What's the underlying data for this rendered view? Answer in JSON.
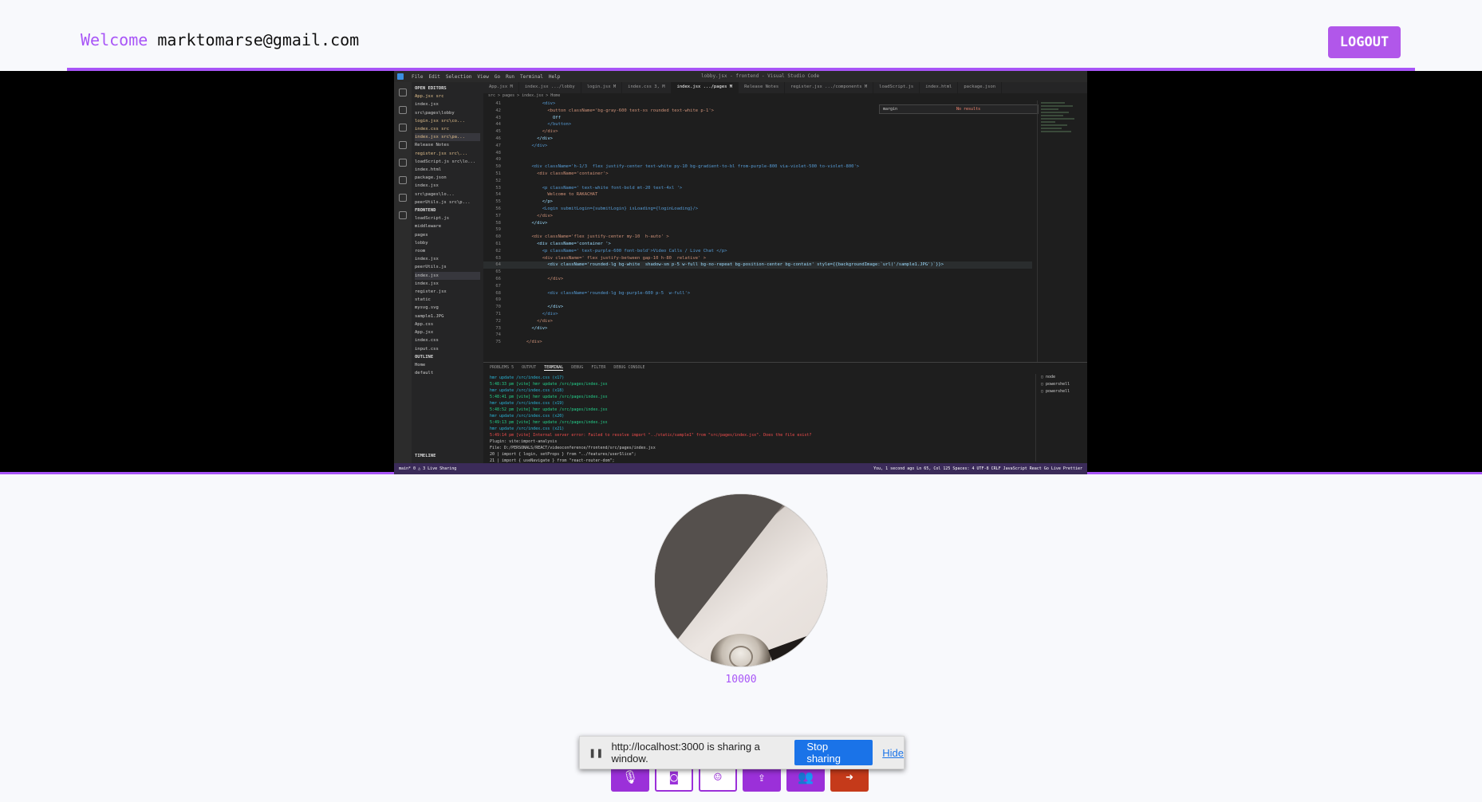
{
  "header": {
    "welcome_label": "Welcome",
    "email": "marktomarse@gmail.com",
    "logout_label": "LOGOUT"
  },
  "shared_screen": {
    "window_title": "lobby.jsx - frontend - Visual Studio Code",
    "menus": [
      "File",
      "Edit",
      "Selection",
      "View",
      "Go",
      "Run",
      "Terminal",
      "Help"
    ],
    "tabs": [
      "App.jsx M",
      "index.jsx .../lobby",
      "login.jsx M",
      "index.css 3, M",
      "index.jsx .../pages M",
      "Release Notes",
      "register.jsx .../components M",
      "loadScript.js",
      "index.html",
      "package.json"
    ],
    "breadcrumb": "src > pages > index.jsx > Home",
    "explorer": {
      "open_editors": "OPEN EDITORS",
      "frontend": "FRONTEND",
      "outline": "OUTLINE",
      "timeline": "TIMELINE",
      "files": [
        "App.jsx src",
        "index.jsx src\\pages\\lobby",
        "login.jsx src\\co...",
        "index.css src",
        "index.jsx src\\pa...",
        "Release Notes",
        "register.jsx src\\...",
        "loadScript.js src\\lo...",
        "index.html",
        "package.json",
        "index.jsx src\\pages\\lo...",
        "peerUtils.js src\\p...",
        "loadScript.js",
        "middleware",
        "pages",
        "lobby",
        "room",
        "index.jsx",
        "peerUtils.js",
        "index.jsx",
        "index.jsx",
        "register.jsx",
        "static",
        "mysvg.svg",
        "sample1.JPG",
        "App.css",
        "App.jsx",
        "index.css",
        "input.css",
        "Home",
        "default"
      ]
    },
    "code_lines": [
      {
        "n": "41",
        "text": "            <div>"
      },
      {
        "n": "42",
        "text": "              <button className='bg-gray-600 text-xs rounded text-white p-1'>"
      },
      {
        "n": "43",
        "text": "                Off"
      },
      {
        "n": "44",
        "text": "              </button>"
      },
      {
        "n": "45",
        "text": "            </div>"
      },
      {
        "n": "46",
        "text": "          </div>"
      },
      {
        "n": "47",
        "text": "        </div>"
      },
      {
        "n": "48",
        "text": ""
      },
      {
        "n": "49",
        "text": ""
      },
      {
        "n": "50",
        "text": "        <div className='h-1/3  flex justify-center text-white py-10 bg-gradient-to-bl from-purple-800 via-violet-500 to-violet-800'>"
      },
      {
        "n": "51",
        "text": "          <div className='container'>"
      },
      {
        "n": "52",
        "text": ""
      },
      {
        "n": "53",
        "text": "            <p className=' text-white font-bold mt-20 text-4xl '>"
      },
      {
        "n": "54",
        "text": "              Welcome to RAKACHAT"
      },
      {
        "n": "55",
        "text": "            </p>"
      },
      {
        "n": "56",
        "text": "            <Login submitLogin={submitLogin} isLoading={loginLoading}/>"
      },
      {
        "n": "57",
        "text": "          </div>"
      },
      {
        "n": "58",
        "text": "        </div>"
      },
      {
        "n": "59",
        "text": ""
      },
      {
        "n": "60",
        "text": "        <div className='flex justify-center my-10  h-auto' >"
      },
      {
        "n": "61",
        "text": "          <div className='container '>"
      },
      {
        "n": "62",
        "text": "            <p className=' text-purple-600 font-bold'>Video Calls / Live Chat </p>"
      },
      {
        "n": "63",
        "text": "            <div className=' flex justify-between gap-10 h-80  relative' >"
      },
      {
        "n": "64",
        "text": "              <div className='rounded-lg bg-white  shadow-sm p-5 w-full bg-no-repeat bg-position-center bg-contain' style={{backgroundImage:`url('/sample1.JPG')`}}>"
      },
      {
        "n": "65",
        "text": ""
      },
      {
        "n": "66",
        "text": "              </div>"
      },
      {
        "n": "67",
        "text": ""
      },
      {
        "n": "68",
        "text": "              <div className='rounded-lg bg-purple-600 p-5  w-full'>"
      },
      {
        "n": "69",
        "text": ""
      },
      {
        "n": "70",
        "text": "              </div>"
      },
      {
        "n": "71",
        "text": "            </div>"
      },
      {
        "n": "72",
        "text": "          </div>"
      },
      {
        "n": "73",
        "text": "        </div>"
      },
      {
        "n": "74",
        "text": ""
      },
      {
        "n": "75",
        "text": "      </div>"
      }
    ],
    "find_text": "margin",
    "find_result": "No results",
    "panel_tabs": [
      "PROBLEMS 5",
      "OUTPUT",
      "TERMINAL",
      "DEBUG",
      "FILTER",
      "DEBUG CONSOLE"
    ],
    "terminal_lines": [
      "hmr update /src/index.css (x17)",
      "5:48:33 pm [vite] hmr update /src/pages/index.jsx",
      "hmr update /src/index.css (x18)",
      "5:48:41 pm [vite] hmr update /src/pages/index.jsx",
      "hmr update /src/index.css (x19)",
      "5:48:52 pm [vite] hmr update /src/pages/index.jsx",
      "hmr update /src/index.css (x20)",
      "5:49:13 pm [vite] hmr update /src/pages/index.jsx",
      "hmr update /src/index.css (x21)",
      "5:49:14 pm [vite] Internal server error: Failed to resolve import \"../static/sample1\" from \"src/pages/index.jsx\". Does the file exist?",
      "  Plugin: vite:import-analysis",
      "  File: D:/PERSONALS/REACT/videoconference/frontend/src/pages/index.jsx",
      "  20 |  import { login, setProps } from \"../features/userSlice\";",
      "  21 |  import { useNavigate } from \"react-router-dom\";"
    ],
    "terminal_list": [
      "node",
      "powershell",
      "powershell"
    ],
    "status_left": "main*  0 △ 3  Live Sharing",
    "status_right": "You, 1 second ago   Ln 65, Col 125   Spaces: 4   UTF-8   CRLF   JavaScript React   Go Live   Prettier"
  },
  "participant": {
    "id_label": "10000"
  },
  "controls": {
    "mic_icon": "microphone-icon",
    "camera_icon": "camera-icon",
    "emoji_icon": "emoji-icon",
    "share_icon": "screen-share-icon",
    "users_icon": "users-icon",
    "leave_icon": "leave-icon"
  },
  "share_bar": {
    "message": "http://localhost:3000 is sharing a window.",
    "stop_label": "Stop sharing",
    "hide_label": "Hide"
  },
  "colors": {
    "accent": "#a855f7",
    "button_purple": "#9b30d9",
    "leave_red": "#c53a1a",
    "chrome_blue": "#1a73e8"
  }
}
